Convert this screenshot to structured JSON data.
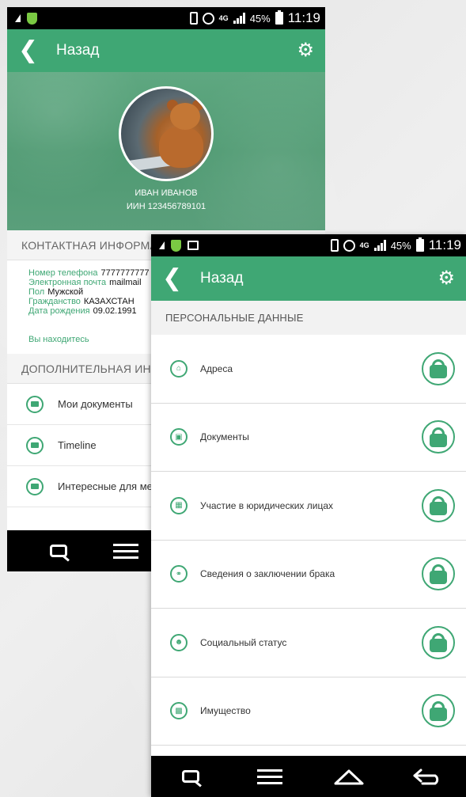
{
  "status_bar": {
    "battery": "45%",
    "time": "11:19",
    "network": "4G"
  },
  "phone1": {
    "appbar": {
      "title": "Назад"
    },
    "profile": {
      "name": "ИВАН ИВАНОВ",
      "iin_label": "ИИН",
      "iin_value": "123456789101"
    },
    "contact_section": "КОНТАКТНАЯ ИНФОРМАЦ",
    "contact": [
      {
        "key": "Номер телефона",
        "value": "7777777777"
      },
      {
        "key": "Электронная почта",
        "value": "mailmail"
      },
      {
        "key": "Пол",
        "value": "Мужской"
      },
      {
        "key": "Гражданство",
        "value": "КАЗАХСТАН"
      },
      {
        "key": "Дата рождения",
        "value": "09.02.1991"
      }
    ],
    "location_link": "Вы находитесь",
    "extra_section": "ДОПОЛНИТЕЛЬНАЯ ИНФ",
    "extra_items": [
      "Мои документы",
      "Timeline",
      "Интересные для ме"
    ]
  },
  "phone2": {
    "appbar": {
      "title": "Назад"
    },
    "section": "ПЕРСОНАЛЬНЫЕ ДАННЫЕ",
    "items": [
      {
        "label": "Адреса",
        "icon": "home-icon"
      },
      {
        "label": "Документы",
        "icon": "id-card-icon"
      },
      {
        "label": "Участие в юридических лицах",
        "icon": "company-icon"
      },
      {
        "label": "Сведения о заключении брака",
        "icon": "couple-icon"
      },
      {
        "label": "Социальный статус",
        "icon": "social-status-icon"
      },
      {
        "label": "Имущество",
        "icon": "property-icon"
      }
    ]
  },
  "colors": {
    "accent": "#3fa774",
    "statusbar": "#000000"
  }
}
